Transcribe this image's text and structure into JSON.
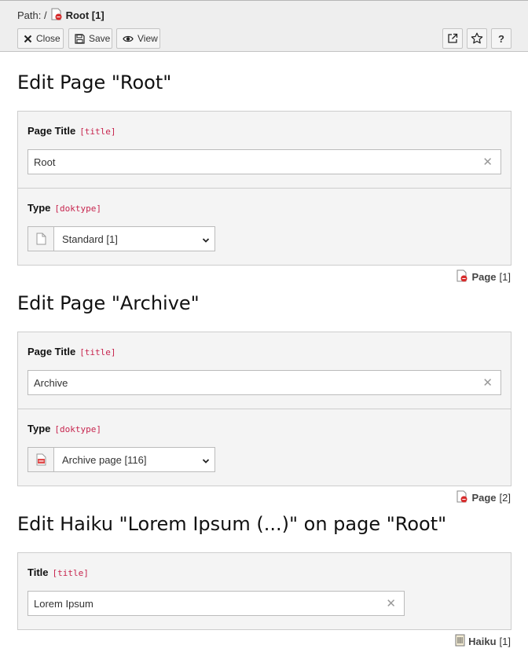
{
  "header": {
    "path_label": "Path: /",
    "page_name": "Root [1]",
    "buttons": {
      "close": "Close",
      "save": "Save",
      "view": "View",
      "help": "?"
    }
  },
  "sections": [
    {
      "heading": "Edit Page \"Root\"",
      "title_label": "Page Title",
      "title_field": "[title]",
      "title_value": "Root",
      "type_label": "Type",
      "type_field": "[doktype]",
      "type_value": "Standard [1]",
      "record_type": "Page",
      "record_id": "[1]"
    },
    {
      "heading": "Edit Page \"Archive\"",
      "title_label": "Page Title",
      "title_field": "[title]",
      "title_value": "Archive",
      "type_label": "Type",
      "type_field": "[doktype]",
      "type_value": "Archive page [116]",
      "record_type": "Page",
      "record_id": "[2]"
    },
    {
      "heading": "Edit Haiku \"Lorem Ipsum (...)\" on page \"Root\"",
      "title_label": "Title",
      "title_field": "[title]",
      "title_value": "Lorem Ipsum",
      "record_type": "Haiku",
      "record_id": "[1]"
    }
  ],
  "colors": {
    "field_name": "#c7254e",
    "header_bg": "#eeeeee",
    "panel_bg": "#f4f4f4",
    "page_icon_badge": "#d62a2a"
  }
}
